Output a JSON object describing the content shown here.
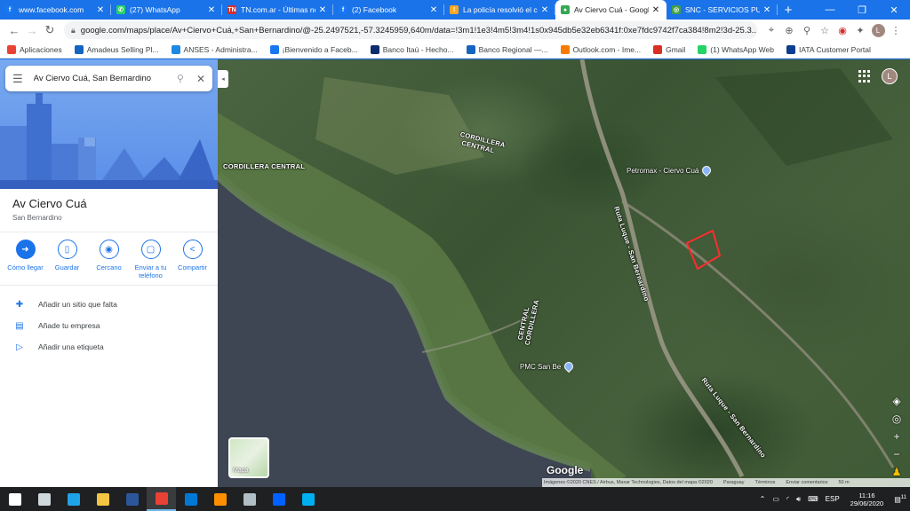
{
  "browser": {
    "tabs": [
      {
        "title": "www.facebook.com",
        "favicon": "facebook-favicon",
        "color": "#1877f2",
        "glyph": "f",
        "active": false
      },
      {
        "title": "(27) WhatsApp",
        "favicon": "whatsapp-favicon",
        "color": "#25d366",
        "glyph": "✆",
        "active": false
      },
      {
        "title": "TN.com.ar - Últimas no",
        "favicon": "tn-favicon",
        "color": "#d32f2f",
        "glyph": "TN",
        "active": false
      },
      {
        "title": "(2) Facebook",
        "favicon": "facebook-favicon",
        "color": "#1877f2",
        "glyph": "f",
        "active": false
      },
      {
        "title": "La policía resolvió el ca",
        "favicon": "news-favicon",
        "color": "#f9a825",
        "glyph": "!",
        "active": false
      },
      {
        "title": "Av Ciervo Cuá - Googl",
        "favicon": "google-maps-favicon",
        "color": "#34a853",
        "glyph": "●",
        "active": true
      },
      {
        "title": "SNC - SERVICIOS PUB",
        "favicon": "globe-favicon",
        "color": "#43a047",
        "glyph": "◎",
        "active": false
      }
    ],
    "new_tab_label": "+",
    "url": "google.com/maps/place/Av+Ciervo+Cuá,+San+Bernardino/@-25.2497521,-57.3245959,640m/data=!3m1!1e3!4m5!3m4!1s0x945db5e32eb6341f:0xe7fdc9742f7ca384!8m2!3d-25.3...",
    "profile_initial": "L",
    "bookmarks": [
      {
        "label": "Aplicaciones",
        "color": "#ea4335"
      },
      {
        "label": "Amadeus Selling Pl...",
        "color": "#1565c0"
      },
      {
        "label": "ANSES - Administra...",
        "color": "#1e88e5"
      },
      {
        "label": "¡Bienvenido a Faceb...",
        "color": "#1877f2"
      },
      {
        "label": "Banco Itaú - Hecho...",
        "color": "#0d2c6c"
      },
      {
        "label": "Banco Regional —...",
        "color": "#1565c0"
      },
      {
        "label": "Outlook.com - Ime...",
        "color": "#f57c00"
      },
      {
        "label": "Gmail",
        "color": "#d93025"
      },
      {
        "label": "(1) WhatsApp Web",
        "color": "#25d366"
      },
      {
        "label": "IATA Customer Portal",
        "color": "#0b3d91"
      }
    ]
  },
  "panel": {
    "search_value": "Av Ciervo Cuá, San Bernardino",
    "place_title": "Av Ciervo Cuá",
    "place_subtitle": "San Bernardino",
    "actions": [
      {
        "label": "Cómo llegar",
        "icon": "directions-icon",
        "glyph": "➜",
        "filled": true
      },
      {
        "label": "Guardar",
        "icon": "bookmark-icon",
        "glyph": "▯",
        "filled": false
      },
      {
        "label": "Cercano",
        "icon": "nearby-icon",
        "glyph": "◉",
        "filled": false
      },
      {
        "label": "Enviar a tu teléfono",
        "icon": "send-to-phone-icon",
        "glyph": "▢",
        "filled": false
      },
      {
        "label": "Compartir",
        "icon": "share-icon",
        "glyph": "<",
        "filled": false
      }
    ],
    "list": [
      {
        "label": "Añadir un sitio que falta",
        "icon": "add-place-icon",
        "glyph": "✚"
      },
      {
        "label": "Añade tu empresa",
        "icon": "add-business-icon",
        "glyph": "▤"
      },
      {
        "label": "Añadir una etiqueta",
        "icon": "label-icon",
        "glyph": "▷"
      }
    ]
  },
  "map": {
    "labels": {
      "cordillera_1": "CORDILLERA CENTRAL",
      "cordillera_2": "CORDILLERA CENTRAL",
      "cordillera_3": "CENTRAL CORDILLERA",
      "ruta_1": "Ruta Luque - San Bernardino",
      "ruta_2": "Ruta Luque - San Bernardino"
    },
    "pois": {
      "petromax": "Petromax - Ciervo Cuá",
      "pmc": "PMC San Be"
    },
    "layer_label": "Mapa",
    "google_logo": "Google",
    "attribution": {
      "imagery": "Imágenes ©2020 CNES / Airbus, Maxar Technologies, Datos del mapa ©2020",
      "country": "Paraguay",
      "terms": "Términos",
      "feedback": "Enviar comentarios",
      "scale": "50 m"
    },
    "highlight_color": "#ff2d2d"
  },
  "taskbar": {
    "apps": [
      {
        "name": "windows-start-icon",
        "color": "#ffffff"
      },
      {
        "name": "task-view-icon",
        "color": "#cfd8dc"
      },
      {
        "name": "edge-icon",
        "color": "#1fa3e8"
      },
      {
        "name": "file-explorer-icon",
        "color": "#f4c542"
      },
      {
        "name": "word-icon",
        "color": "#2b579a"
      },
      {
        "name": "chrome-icon",
        "color": "#e94235",
        "active": true
      },
      {
        "name": "mail-icon",
        "color": "#0078d4"
      },
      {
        "name": "media-icon",
        "color": "#ff8f00"
      },
      {
        "name": "photos-icon",
        "color": "#b0bec5"
      },
      {
        "name": "dropbox-icon",
        "color": "#0061fe"
      },
      {
        "name": "skype-icon",
        "color": "#00aff0"
      }
    ],
    "language": "ESP",
    "time": "11:16",
    "date": "29/06/2020",
    "notifications": "11"
  }
}
